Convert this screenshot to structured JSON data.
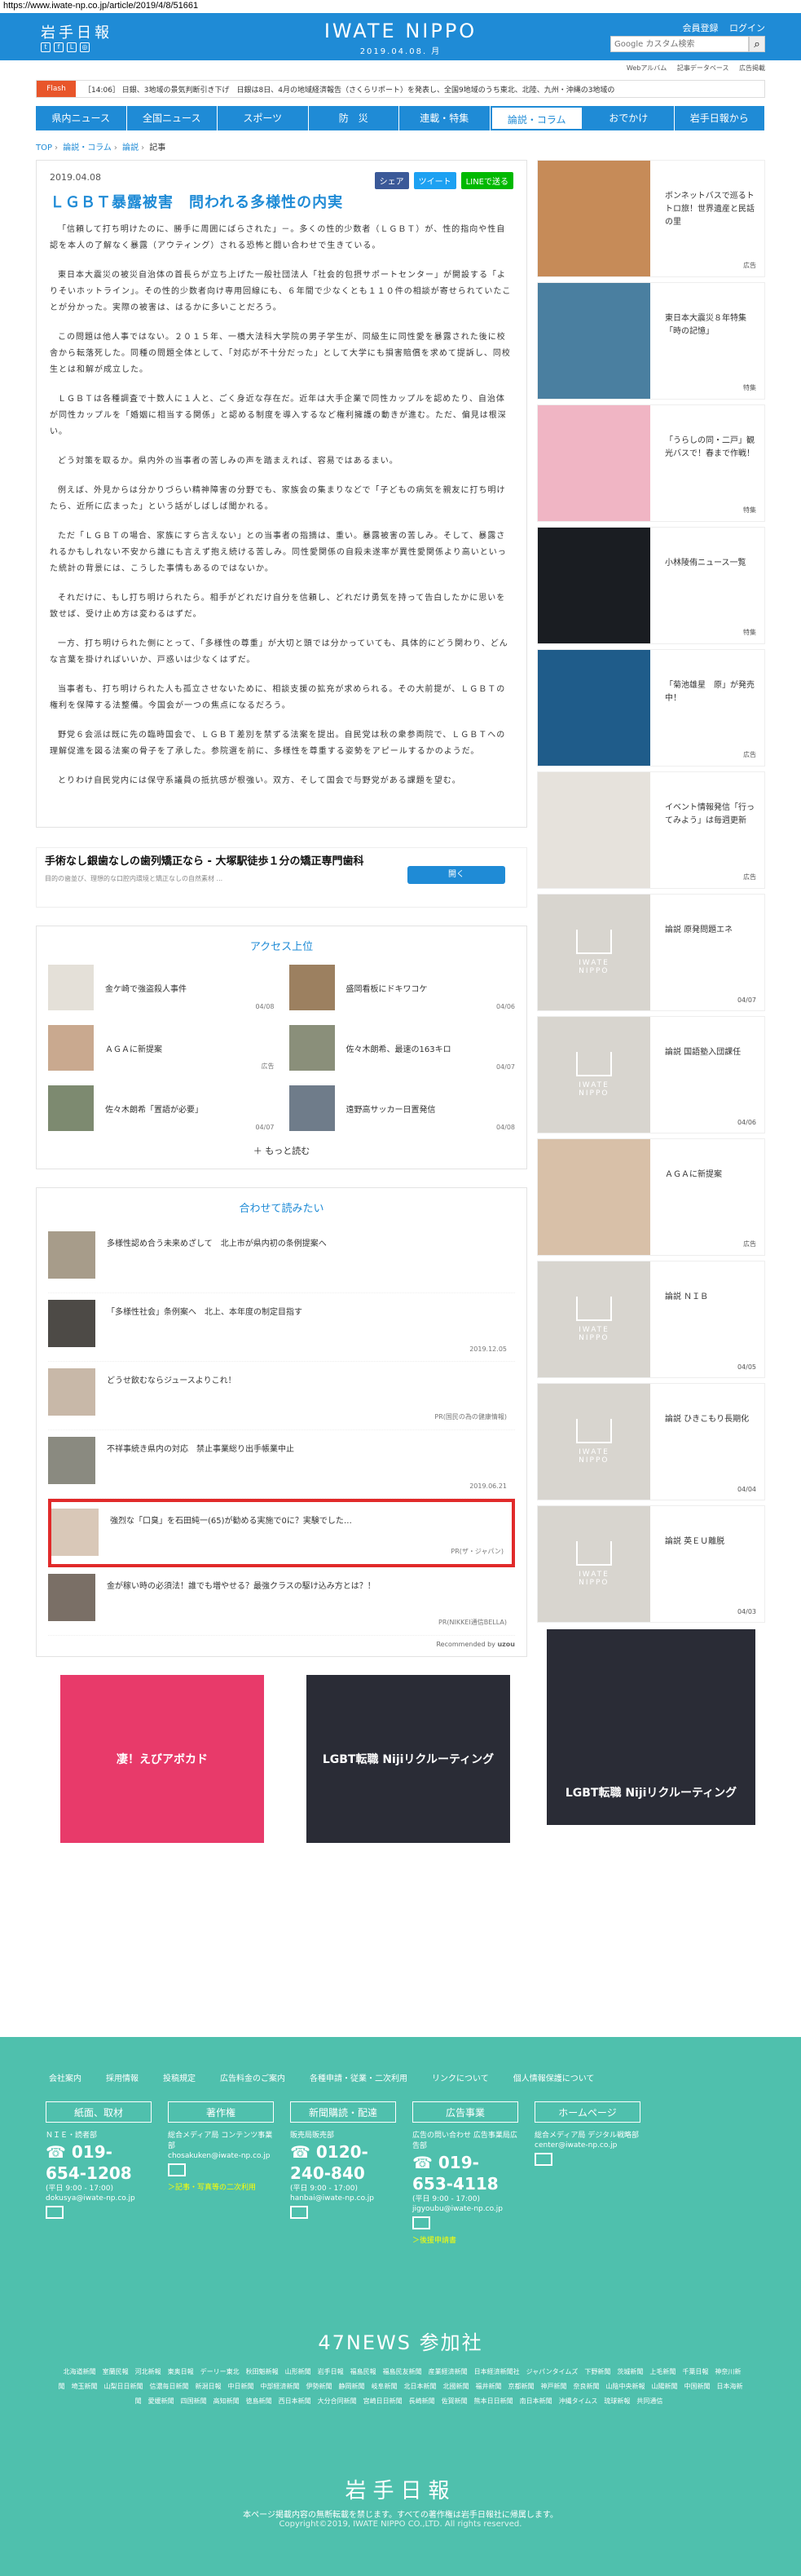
{
  "url": "https://www.iwate-np.co.jp/article/2019/4/8/51661",
  "header": {
    "logo_jp": "岩手日報",
    "brand": "IWATE NIPPO",
    "date": "2019.04.08. 月",
    "links": [
      "会員登録",
      "ログイン"
    ],
    "search_placeholder": "Google カスタム検索",
    "subnav": [
      "Webアルバム",
      "記事データベース",
      "広告掲載"
    ]
  },
  "flash": {
    "tag": "Flash",
    "text": "［14:06］ 日銀、3地域の景気判断引き下げ　日銀は8日、4月の地域経済報告（さくらリポート）を発表し、全国9地域のうち東北、北陸、九州・沖縄の3地域の"
  },
  "gnav": [
    "県内ニュース",
    "全国ニュース",
    "スポーツ",
    "防　災",
    "連載・特集",
    "論説・コラム",
    "おでかけ",
    "岩手日報から"
  ],
  "breadcrumb": [
    "TOP",
    "論説・コラム",
    "論説",
    "記事"
  ],
  "article": {
    "date": "2019.04.08",
    "share": [
      "シェア",
      "ツイート",
      "LINEで送る"
    ],
    "title": "ＬＧＢＴ暴露被害　問われる多様性の内実",
    "paragraphs": [
      "「信頼して打ち明けたのに、勝手に周囲にばらされた」－。多くの性的少数者（ＬＧＢＴ）が、性的指向や性自認を本人の了解なく暴露（アウティング）される恐怖と闘い合わせで生きている。",
      "東日本大震災の被災自治体の首長らが立ち上げた一般社団法人「社会的包摂サポートセンター」が開設する「よりそいホットライン」。その性的少数者向け専用回線にも、６年間で少なくとも１１０件の相談が寄せられていたことが分かった。実際の被害は、はるかに多いことだろう。",
      "この問題は他人事ではない。２０１５年、一橋大法科大学院の男子学生が、同級生に同性愛を暴露された後に校舎から転落死した。同種の問題全体として、「対応が不十分だった」として大学にも損害賠償を求めて提訴し、同校生とは和解が成立した。",
      "ＬＧＢＴは各種調査で十数人に１人と、ごく身近な存在だ。近年は大手企業で同性カップルを認めたり、自治体が同性カップルを「婚姻に相当する関係」と認める制度を導入するなど権利擁護の動きが進む。ただ、偏見は根深い。",
      "どう対策を取るか。県内外の当事者の苦しみの声を踏まえれば、容易ではあるまい。",
      "例えば、外見からは分かりづらい精神障害の分野でも、家族会の集まりなどで「子どもの病気を親友に打ち明けたら、近所に広まった」という話がしばしば聞かれる。",
      "ただ「ＬＧＢＴの場合、家族にすら言えない」との当事者の指摘は、重い。暴露被害の苦しみ。そして、暴露されるかもしれない不安から誰にも言えず抱え続ける苦しみ。同性愛関係の自殺未遂率が異性愛関係より高いといった統計の背景には、こうした事情もあるのではないか。",
      "それだけに、もし打ち明けられたら。相手がどれだけ自分を信頼し、どれだけ勇気を持って告白したかに思いを致せば、受け止め方は変わるはずだ。",
      "一方、打ち明けられた側にとって、「多様性の尊重」が大切と頭では分かっていても、具体的にどう関わり、どんな言葉を掛ければいいか、戸惑いは少なくはずだ。",
      "当事者も、打ち明けられた人も孤立させないために、相談支援の拡充が求められる。その大前提が、ＬＧＢＴの権利を保障する法整備。今国会が一つの焦点になるだろう。",
      "野党６会派は既に先の臨時国会で、ＬＧＢＴ差別を禁ずる法案を提出。自民党は秋の衆参両院で、ＬＧＢＴへの理解促進を図る法案の骨子を了承した。参院選を前に、多様性を尊重する姿勢をアピールするかのようだ。",
      "とりわけ自民党内には保守系議員の抵抗感が根強い。双方、そして国会で与野党がある課題を望む。"
    ]
  },
  "ad_banner": {
    "title": "手術なし銀歯なしの歯列矯正なら - 大塚駅徒歩１分の矯正専門歯科",
    "sub": "目的の歯並び、理想的な口腔内環境と矯正なしの自然素材 ...",
    "button": "開く"
  },
  "ranking": {
    "title": "アクセス上位",
    "items": [
      {
        "title": "金ケ崎で強盗殺人事件",
        "date": "04/08"
      },
      {
        "title": "盛岡看板にドキワコケ",
        "date": "04/06"
      },
      {
        "title": "ＡＧＡに新提案",
        "date": "広告"
      },
      {
        "title": "佐々木朗希、最速の163キロ",
        "date": "04/07"
      },
      {
        "title": "佐々木朗希「置語が必要」",
        "date": "04/07"
      },
      {
        "title": "遠野高サッカー日置発信",
        "date": "04/08"
      }
    ],
    "more": "もっと読む"
  },
  "related": {
    "title": "合わせて読みたい",
    "items": [
      {
        "title": "多様性認め合う未来めざして　北上市が県内初の条例提案へ",
        "date": ""
      },
      {
        "title": "「多様性社会」条例案へ　北上、本年度の制定目指す",
        "date": "2019.12.05"
      },
      {
        "title": "どうせ飲むならジュースよりこれ！",
        "date": "PR(国民の為の健康情報)"
      },
      {
        "title": "不祥事続き県内の対応　禁止事業総り出手帳業中止",
        "date": "2019.06.21"
      },
      {
        "title": "強烈な「口臭」を石田純一(65)が勧める実施で0に？実験でした…",
        "date": "PR(ザ・ジャパン)"
      },
      {
        "title": "金が稼い時の必須法！誰でも増やせる？最強クラスの駆け込み方とは？！",
        "date": "PR(NIKKEI通信BELLA)"
      }
    ],
    "recommended": "Recommended by"
  },
  "sidebar": [
    {
      "title": "ボンネットバスで巡るトトロ旅！世界遺産と民話の里",
      "cat": "広告"
    },
    {
      "title": "東日本大震災８年特集「時の記憶」",
      "cat": "特集"
    },
    {
      "title": "「うらしの同・二戸」観光バスで！春まで作戦！",
      "cat": "特集"
    },
    {
      "title": "小林陵侑ニュース一覧",
      "cat": "特集"
    },
    {
      "title": "「菊池雄星　原」が発売中！",
      "cat": "広告"
    },
    {
      "title": "イベント情報発信「行ってみよう」は毎週更新",
      "cat": "広告"
    },
    {
      "title": "論説 原発問題エネ",
      "cat": "04/07"
    },
    {
      "title": "論説 国語塾入団課任",
      "cat": "04/06"
    },
    {
      "title": "ＡＧＡに新提案",
      "cat": "広告"
    },
    {
      "title": "論説 ＮＩＢ",
      "cat": "04/05"
    },
    {
      "title": "論説 ひきこもり長期化",
      "cat": "04/04"
    },
    {
      "title": "論説 英ＥＵ離脱",
      "cat": "04/03"
    }
  ],
  "side_ad": "LGBT転職 Nijiリクルーティング",
  "ads_bottom": [
    "凄！えびアボカド",
    "LGBT転職 Nijiリクルーティング"
  ],
  "footer": {
    "links": [
      "会社案内",
      "採用情報",
      "投稿規定",
      "広告料金のご案内",
      "各種申請・従業・二次利用",
      "リンクについて",
      "個人情報保護について"
    ],
    "cols": [
      {
        "h": "紙面、取材",
        "l": "ＮＩＥ・読者部",
        "tel": "019-654-1208",
        "hours": "(平日 9:00 - 17:00)",
        "mail": "dokusya@iwate-np.co.jp",
        "link": ""
      },
      {
        "h": "著作権",
        "l": "総合メディア局 コンテンツ事業部",
        "tel": "",
        "hours": "",
        "mail": "chosakuken@iwate-np.co.jp",
        "link": "＞記事・写真等の二次利用"
      },
      {
        "h": "新聞購読・配達",
        "l": "販売局販売部",
        "tel": "0120-240-840",
        "hours": "(平日 9:00 - 17:00)",
        "mail": "hanbai@iwate-np.co.jp",
        "link": ""
      },
      {
        "h": "広告事業",
        "l": "広告の問い合わせ 広告事業局広告部",
        "tel": "019-653-4118",
        "hours": "(平日 9:00 - 17:00)",
        "mail": "jigyoubu@iwate-np.co.jp",
        "link": "＞後援申請書"
      },
      {
        "h": "ホームページ",
        "l": "総合メディア局 デジタル戦略部",
        "tel": "",
        "hours": "",
        "mail": "center@iwate-np.co.jp",
        "link": ""
      }
    ],
    "n47_title": "47NEWS 参加社",
    "n47": [
      "北海道新聞",
      "室蘭民報",
      "河北新報",
      "東奥日報",
      "デーリー東北",
      "秋田魁新報",
      "山形新聞",
      "岩手日報",
      "福島民報",
      "福島民友新聞",
      "産業経済新聞",
      "日本経済新聞社",
      "ジャパンタイムズ",
      "下野新聞",
      "茨城新聞",
      "上毛新聞",
      "千葉日報",
      "神奈川新聞",
      "埼玉新聞",
      "山梨日日新聞",
      "信濃毎日新聞",
      "新潟日報",
      "中日新聞",
      "中部経済新聞",
      "伊勢新聞",
      "静岡新聞",
      "岐阜新聞",
      "北日本新聞",
      "北國新聞",
      "福井新聞",
      "京都新聞",
      "神戸新聞",
      "奈良新聞",
      "山陰中央新報",
      "山陽新聞",
      "中国新聞",
      "日本海新聞",
      "愛媛新聞",
      "四国新聞",
      "高知新聞",
      "徳島新聞",
      "西日本新聞",
      "大分合同新聞",
      "宮崎日日新聞",
      "長崎新聞",
      "佐賀新聞",
      "熊本日日新聞",
      "南日本新聞",
      "沖縄タイムス",
      "琉球新報",
      "共同通信"
    ],
    "logo": "岩手日報",
    "copy1": "本ページ掲載内容の無断転載を禁じます。すべての著作権は岩手日報社に帰属します。",
    "copy2": "Copyright©2019, IWATE NIPPO CO.,LTD. All rights reserved."
  },
  "colors": {
    "brand": "#1f8bd6",
    "footer": "#4fc0ad",
    "highlight": "#e12a2a"
  }
}
